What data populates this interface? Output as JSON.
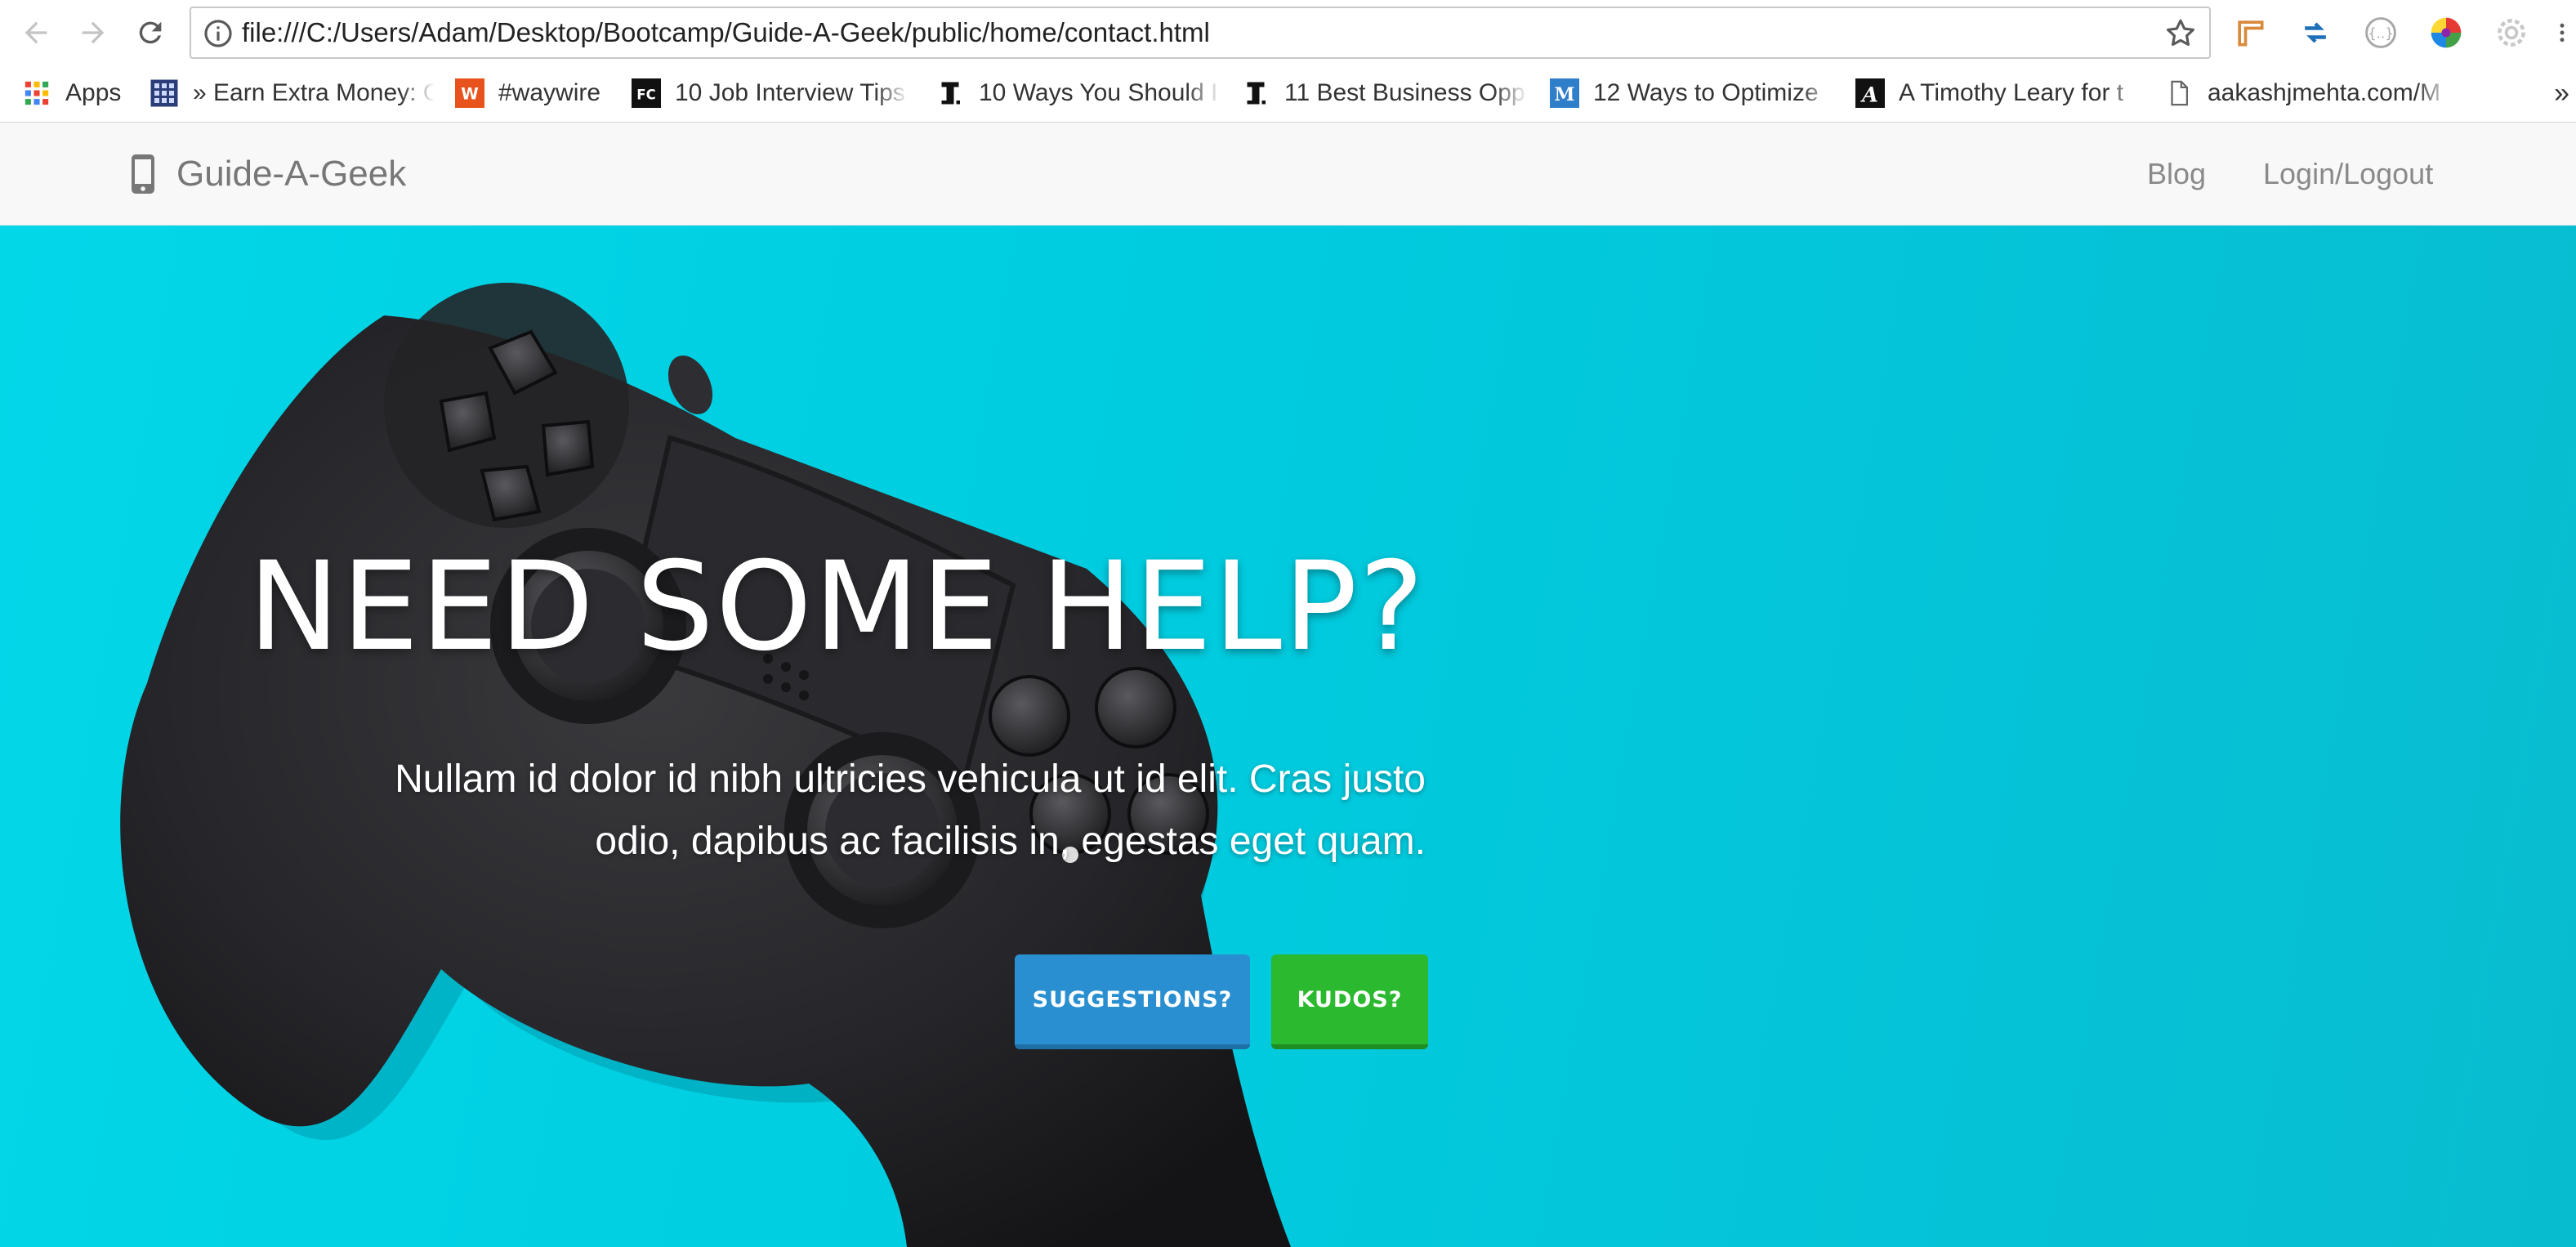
{
  "browser": {
    "url": "file:///C:/Users/Adam/Desktop/Bootcamp/Guide-A-Geek/public/home/contact.html",
    "buttons": [
      "back-icon",
      "forward-icon",
      "reload-icon"
    ],
    "extensions": [
      "ruler-extension-icon",
      "arrows-extension-icon",
      "json-extension-icon",
      "color-wheel-extension-icon",
      "gear-extension-icon"
    ]
  },
  "bookmarks": {
    "items": [
      {
        "label": "Apps",
        "icon": "apps-grid-icon"
      },
      {
        "label": "» Earn Extra Money: C",
        "icon": "calculator-icon"
      },
      {
        "label": "#waywire",
        "icon": "waywire-icon"
      },
      {
        "label": "10 Job Interview Tips",
        "icon": "fc-icon"
      },
      {
        "label": "10 Ways You Should I",
        "icon": "inc-icon"
      },
      {
        "label": "11 Best Business Opp",
        "icon": "inc-icon"
      },
      {
        "label": "12 Ways to Optimize",
        "icon": "m-icon"
      },
      {
        "label": "A Timothy Leary for t",
        "icon": "a-icon"
      },
      {
        "label": "aakashjmehta.com/M",
        "icon": "page-icon"
      }
    ],
    "more": "»"
  },
  "site": {
    "brand": "Guide-A-Geek",
    "nav": {
      "blog": "Blog",
      "login": "Login/Logout"
    }
  },
  "hero": {
    "title": "NEED SOME HELP?",
    "subtitle": "Nullam id dolor id nibh ultricies vehicula ut id elit. Cras justo odio, dapibus ac facilisis in, egestas eget quam.",
    "buttons": {
      "suggestions": "SUGGESTIONS?",
      "kudos": "KUDOS?"
    }
  },
  "colors": {
    "hero_bg": "#00d2e4",
    "primary_button": "#2a8fd0",
    "success_button": "#2bb92f",
    "navbar_bg": "#f8f8f8",
    "brand_text": "#777777"
  }
}
